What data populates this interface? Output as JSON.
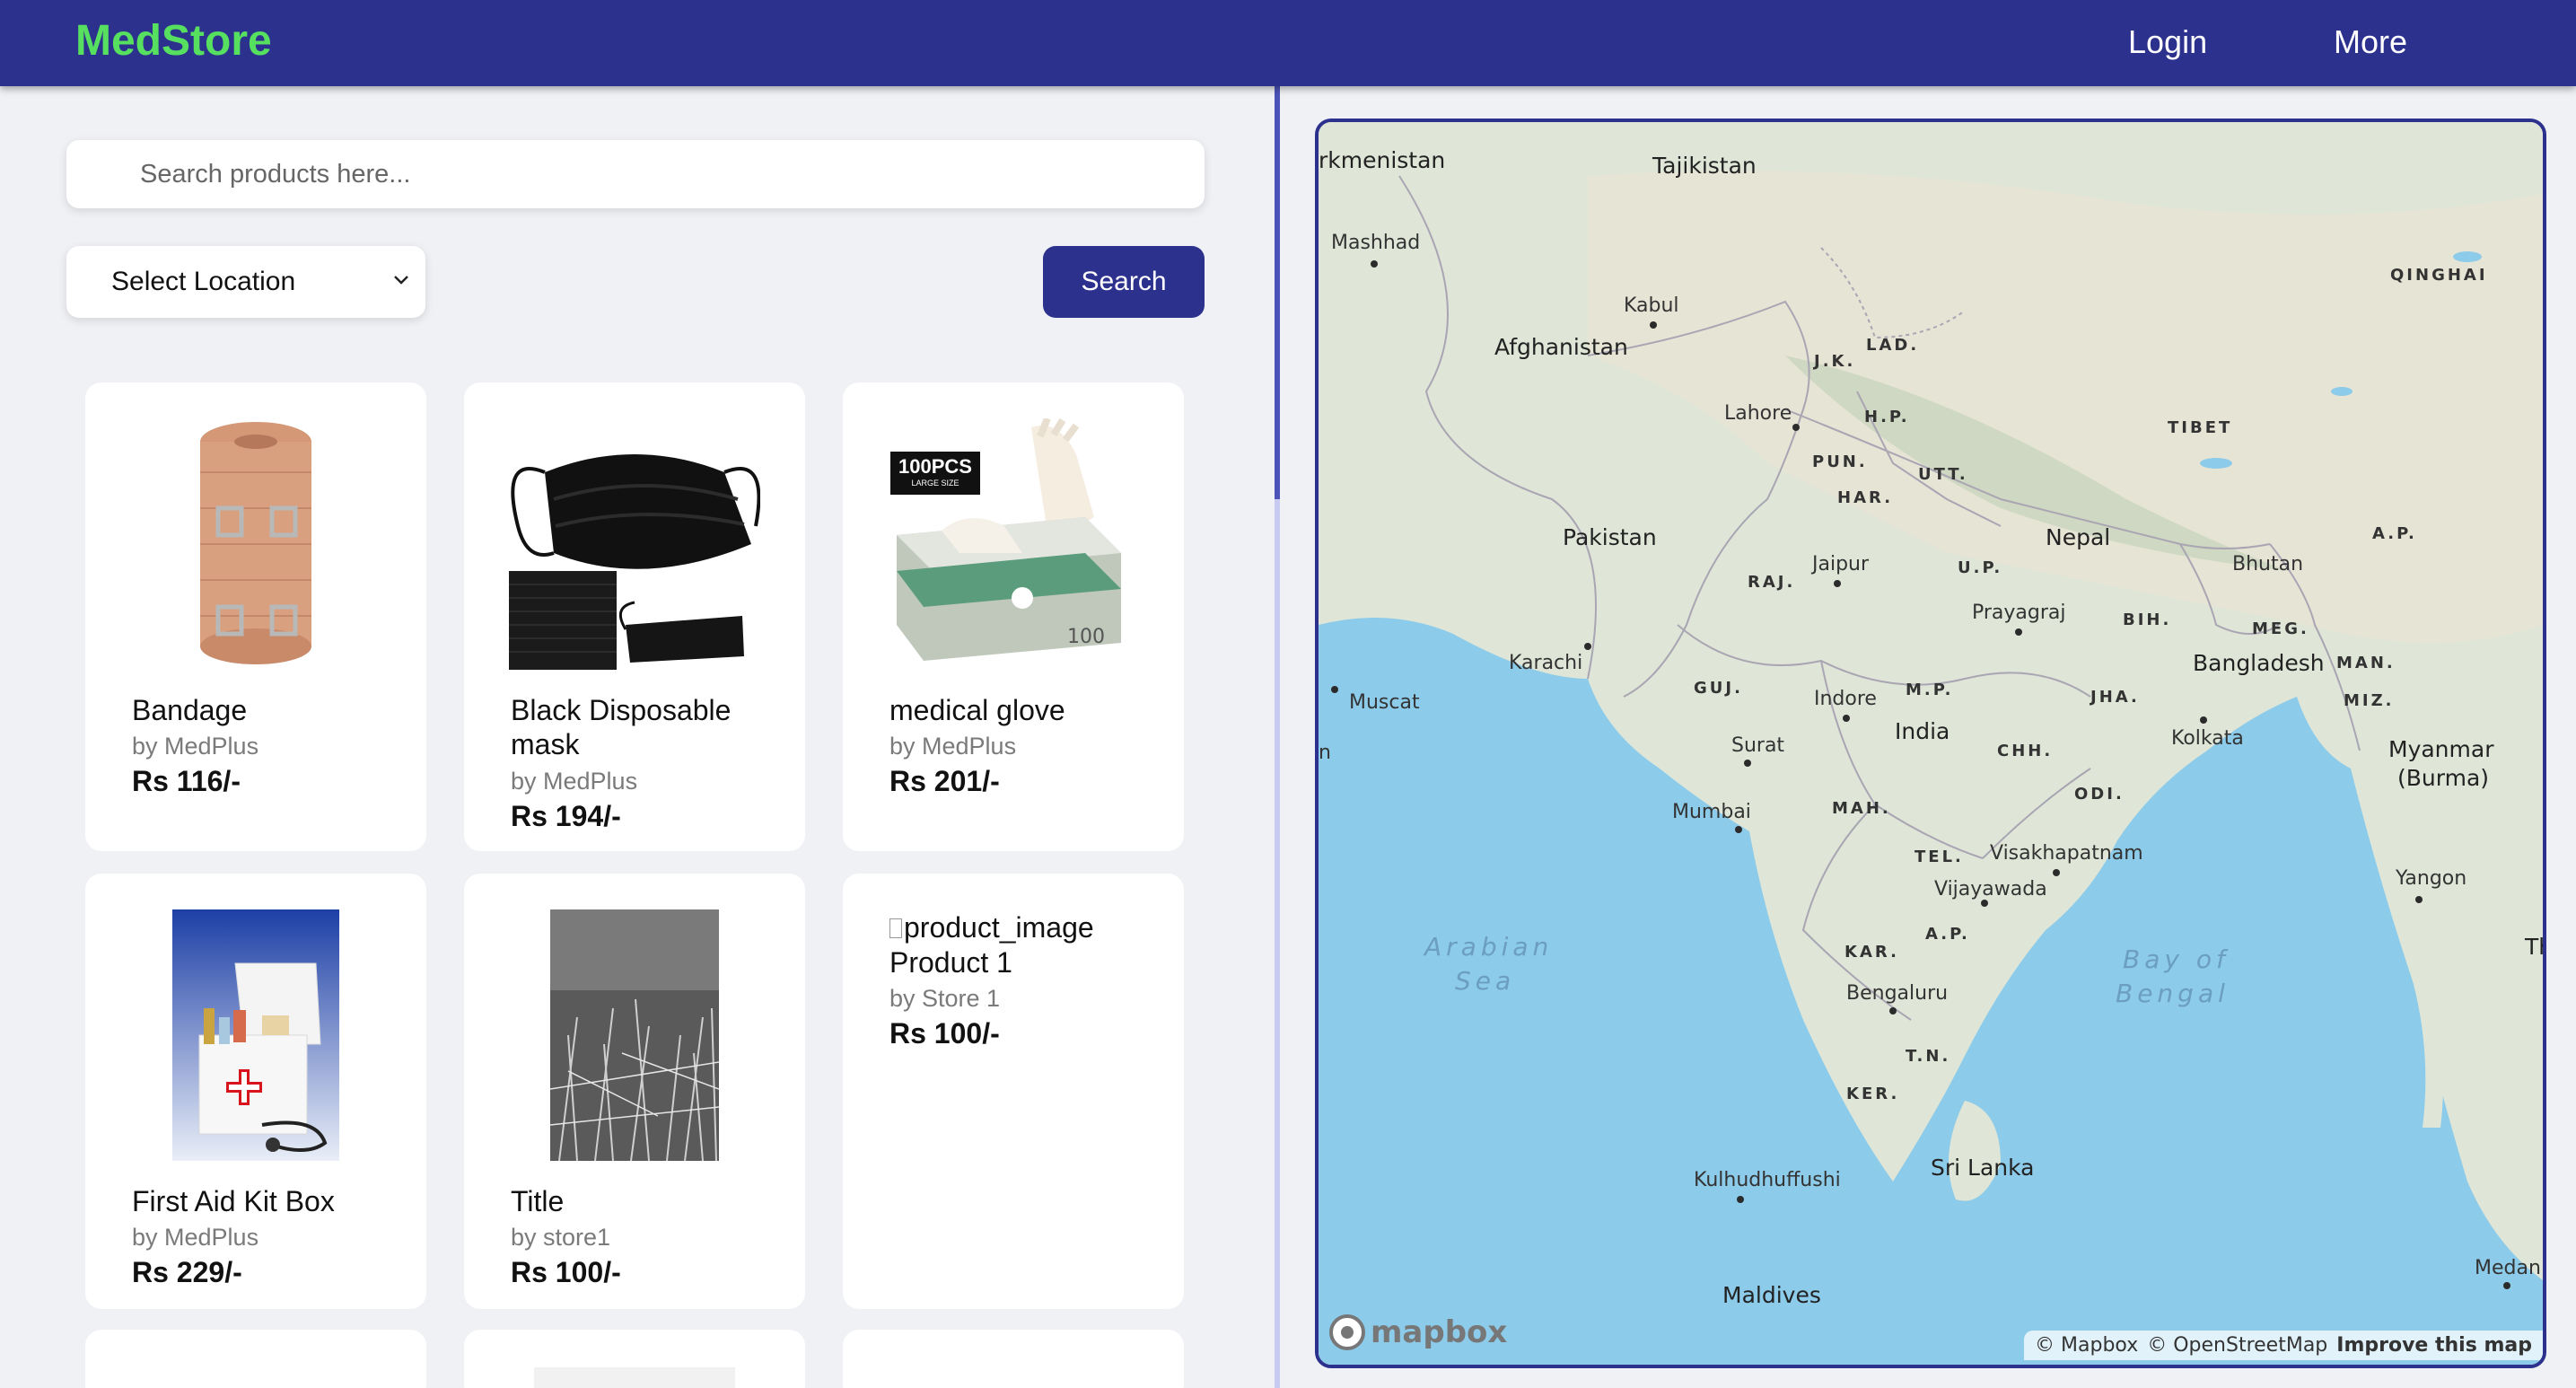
{
  "navbar": {
    "brand": "MedStore",
    "login_label": "Login",
    "more_label": "More",
    "colors": {
      "bar": "#2c318e",
      "brand": "#57e05f"
    }
  },
  "search": {
    "placeholder": "Search products here...",
    "location_label": "Select Location",
    "button_label": "Search"
  },
  "products": [
    {
      "title": "Bandage",
      "store": "by MedPlus",
      "price": "Rs 116/-",
      "image": "bandage-roll"
    },
    {
      "title": "Black Disposable mask",
      "store": "by MedPlus",
      "price": "Rs 194/-",
      "image": "black-masks"
    },
    {
      "title": "medical glove",
      "store": "by MedPlus",
      "price": "Rs 201/-",
      "image": "latex-gloves-box",
      "box_text": "100PCS",
      "box_subtext": "LARGE SIZE"
    },
    {
      "title": "First Aid Kit Box",
      "store": "by MedPlus",
      "price": "Rs 229/-",
      "image": "first-aid-kit"
    },
    {
      "title": "Title",
      "store": "by store1",
      "price": "Rs 100/-",
      "image": "grass-photo"
    },
    {
      "title": "Product 1",
      "store": "by Store 1",
      "price": "Rs 100/-",
      "image": "broken-image",
      "alt": "product_image"
    }
  ],
  "map": {
    "countries": [
      "rkmenistan",
      "Tajikistan",
      "Afghanistan",
      "Pakistan",
      "Nepal",
      "Bhutan",
      "Bangladesh",
      "India",
      "Myanmar",
      "(Burma)",
      "Sri Lanka",
      "Maldives",
      "TIBET",
      "QINGHAI",
      "Th"
    ],
    "cities": [
      "Mashhad",
      "Kabul",
      "Lahore",
      "Jaipur",
      "Prayagraj",
      "Karachi",
      "Muscat",
      "Indore",
      "Surat",
      "Kolkata",
      "Mumbai",
      "Visakhapatnam",
      "Vijayawada",
      "Yangon",
      "Bengaluru",
      "Kulhudhuffushi",
      "Medan",
      "n"
    ],
    "states": [
      "J.K.",
      "LAD.",
      "H.P.",
      "PUN.",
      "UTT.",
      "HAR.",
      "RAJ.",
      "U.P.",
      "A.P.",
      "BIH.",
      "MEG.",
      "MAN.",
      "GUJ.",
      "M.P.",
      "JHA.",
      "MIZ.",
      "CHH.",
      "ODI.",
      "MAH.",
      "TEL.",
      "A.P.",
      "KAR.",
      "T.N.",
      "KER."
    ],
    "water": [
      "Arabian",
      "Sea",
      "Bay of",
      "Bengal"
    ],
    "logo": "mapbox",
    "attribution": {
      "mapbox": "© Mapbox",
      "osm": "© OpenStreetMap",
      "improve": "Improve this map"
    },
    "colors": {
      "land": "#dfe6d7",
      "water": "#8ccbea",
      "frame": "#2c318e"
    }
  }
}
